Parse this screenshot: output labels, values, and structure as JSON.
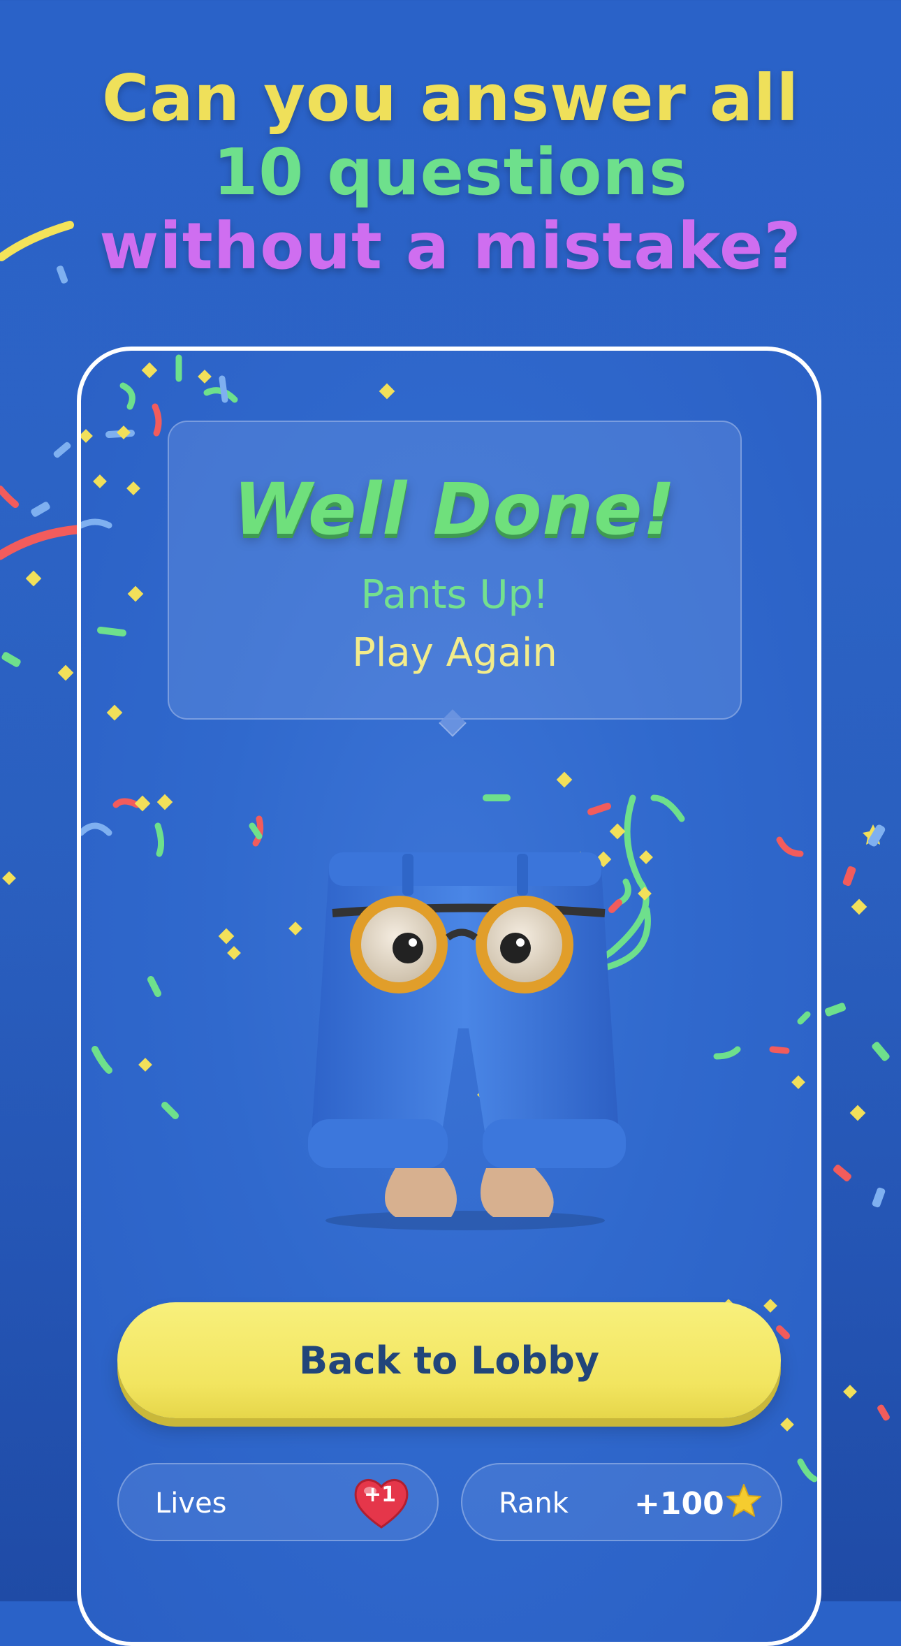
{
  "headline": {
    "line1": "Can you answer all",
    "line2": "10 questions",
    "line3": "without a mistake?"
  },
  "result": {
    "title": "Well Done!",
    "subtitle": "Pants Up!",
    "play_again": "Play Again"
  },
  "lobby_button": "Back to Lobby",
  "stats": {
    "lives_label": "Lives",
    "lives_badge": "+1",
    "rank_label": "Rank",
    "rank_value": "+100"
  },
  "icons": [
    "heart-icon",
    "star-icon",
    "pants-mascot"
  ],
  "colors": {
    "background": "#2a62c8",
    "headline_yellow": "#efe05a",
    "headline_green": "#6ee08c",
    "headline_purple": "#cf6ef0",
    "button_yellow": "#f2e560",
    "button_text": "#21457a"
  }
}
